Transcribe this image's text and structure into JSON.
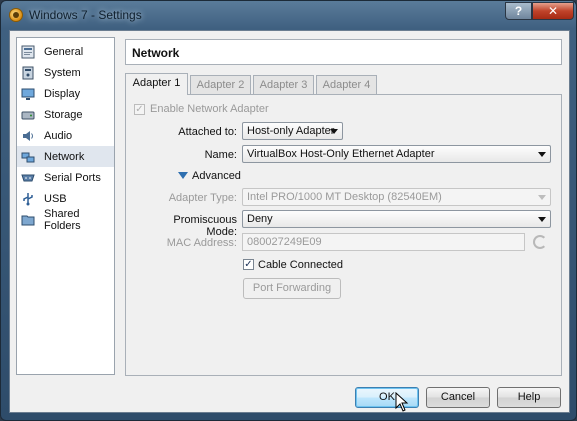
{
  "window": {
    "title": "Windows 7 - Settings",
    "help_label": "?",
    "close_label": "✕"
  },
  "sidebar": {
    "items": [
      {
        "label": "General",
        "icon": "general-icon"
      },
      {
        "label": "System",
        "icon": "system-icon"
      },
      {
        "label": "Display",
        "icon": "display-icon"
      },
      {
        "label": "Storage",
        "icon": "storage-icon"
      },
      {
        "label": "Audio",
        "icon": "audio-icon"
      },
      {
        "label": "Network",
        "icon": "network-icon",
        "selected": true
      },
      {
        "label": "Serial Ports",
        "icon": "serial-ports-icon"
      },
      {
        "label": "USB",
        "icon": "usb-icon"
      },
      {
        "label": "Shared Folders",
        "icon": "shared-folders-icon"
      }
    ]
  },
  "page": {
    "title": "Network"
  },
  "tabs": [
    "Adapter 1",
    "Adapter 2",
    "Adapter 3",
    "Adapter 4"
  ],
  "adapter": {
    "enable_label": "Enable Network Adapter",
    "enable_checked": true,
    "attached_label": "Attached to:",
    "attached_value": "Host-only Adapter",
    "name_label": "Name:",
    "name_value": "VirtualBox Host-Only Ethernet Adapter",
    "advanced_label": "Advanced",
    "adapter_type_label": "Adapter Type:",
    "adapter_type_value": "Intel PRO/1000 MT Desktop (82540EM)",
    "promiscuous_label": "Promiscuous Mode:",
    "promiscuous_value": "Deny",
    "mac_label": "MAC Address:",
    "mac_value": "080027249E09",
    "cable_label": "Cable Connected",
    "cable_checked": true,
    "port_forwarding_label": "Port Forwarding"
  },
  "buttons": {
    "ok": "OK",
    "cancel": "Cancel",
    "help": "Help"
  },
  "colors": {
    "accent": "#3c7fb1",
    "selection": "#e0e6ee"
  }
}
